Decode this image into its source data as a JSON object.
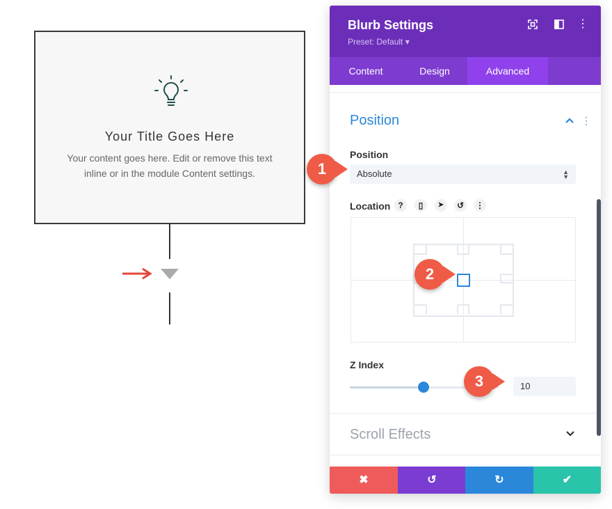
{
  "blurb": {
    "title": "Your Title Goes Here",
    "text_line1": "Your content goes here. Edit or remove this text",
    "text_line2": "inline or in the module Content settings.",
    "icon": "lightbulb-icon"
  },
  "panel": {
    "title": "Blurb Settings",
    "preset": "Preset: Default ▾",
    "header_icons": [
      "fullscreen-icon",
      "sidebar-toggle-icon",
      "more-vertical-icon"
    ],
    "tabs": [
      {
        "label": "Content"
      },
      {
        "label": "Design"
      },
      {
        "label": "Advanced"
      }
    ],
    "active_tab": "Advanced"
  },
  "position": {
    "section_title": "Position",
    "position_label": "Position",
    "position_value": "Absolute",
    "location_label": "Location",
    "location_icons": [
      "help-icon",
      "mobile-icon",
      "cursor-icon",
      "reset-icon",
      "more-vertical-icon"
    ],
    "location_icon_glyphs": [
      "?",
      "▯",
      "➤",
      "↺",
      "⋮"
    ],
    "selected_origin": "center",
    "zindex_label": "Z Index",
    "zindex_value": "10",
    "zindex_slider_fraction": 0.45
  },
  "scroll_effects": {
    "section_title": "Scroll Effects"
  },
  "footer": {
    "cancel": "✖",
    "undo": "↺",
    "redo": "↻",
    "save": "✔"
  },
  "callouts": [
    "1",
    "2",
    "3"
  ],
  "colors": {
    "header": "#6c2eb9",
    "tabs": "#7e3bd0",
    "active_tab": "#8f42ec",
    "accent_blue": "#2b87da",
    "cancel_btn": "#ef5b5b",
    "undo_btn": "#7b3cd2",
    "redo_btn": "#2b87da",
    "save_btn": "#29c4a9",
    "callout": "#ef5b47"
  }
}
